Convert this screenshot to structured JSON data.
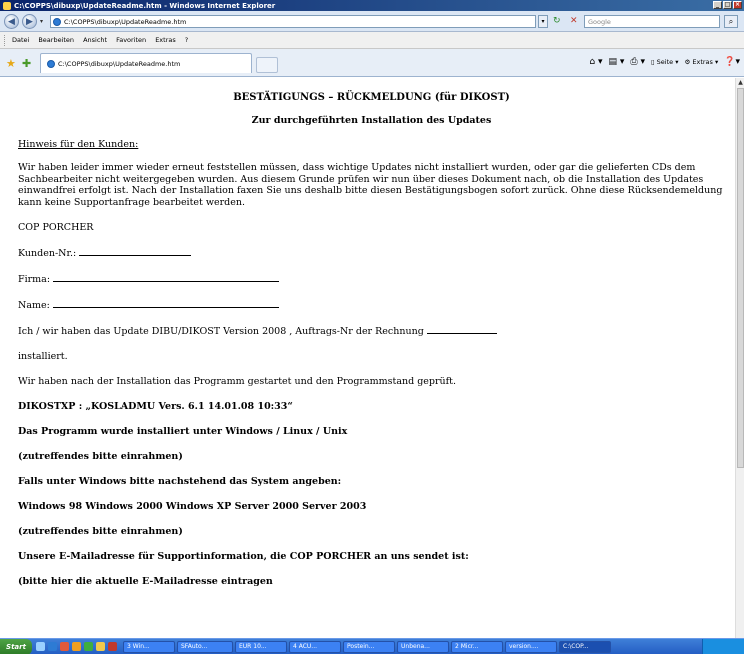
{
  "window": {
    "title": "C:\\COPPS\\dibuxp\\UpdateReadme.htm - Windows Internet Explorer"
  },
  "address_bar": {
    "url": "C:\\COPPS\\dibuxp\\UpdateReadme.htm",
    "search_placeholder": "Google"
  },
  "menu": {
    "items": [
      "Datei",
      "Bearbeiten",
      "Ansicht",
      "Favoriten",
      "Extras",
      "?"
    ]
  },
  "tabs": {
    "active_label": "C:\\COPPS\\dibuxp\\UpdateReadme.htm"
  },
  "command_bar": {
    "page_label": "Seite",
    "extras_label": "Extras"
  },
  "document": {
    "title": "BESTÄTIGUNGS – RÜCKMELDUNG (für DIKOST)",
    "subtitle": "Zur durchgeführten Installation des Updates",
    "hint_heading": "Hinweis für den Kunden:",
    "hint_text": "Wir haben leider immer wieder erneut feststellen müssen, dass wichtige Updates nicht installiert wurden, oder gar die gelieferten CDs dem Sachbearbeiter nicht weitergegeben wurden. Aus diesem Grunde prüfen wir nun über dieses Dokument nach, ob die Installation des Updates einwandfrei erfolgt ist. Nach der Installation faxen Sie uns deshalb bitte diesen Bestätigungsbogen sofort zurück. Ohne diese Rücksendemeldung kann keine Supportanfrage bearbeitet werden.",
    "company": "COP PORCHER",
    "customer_no_label": "Kunden-Nr.:",
    "firma_label": "Firma:",
    "name_label": "Name:",
    "update_sentence": "Ich / wir haben das Update DIBU/DIKOST Version 2008 , Auftrags-Nr der Rechnung",
    "installed": "installiert.",
    "started_sentence": "Wir haben nach der Installation das Programm gestartet und den Programmstand geprüft.",
    "version_line": "DIKOSTXP : „KOSLADMU Vers. 6.1 14.01.08 10:33“",
    "os_line": "Das Programm wurde installiert unter Windows / Linux / Unix",
    "mark_hint_1": "(zutreffendes bitte einrahmen)",
    "windows_prompt": "Falls unter Windows bitte nachstehend das System angeben:",
    "windows_versions": "Windows 98 Windows 2000 Windows XP Server 2000 Server 2003",
    "mark_hint_2": "(zutreffendes bitte einrahmen)",
    "email_prompt": "Unsere E-Mailadresse für Supportinformation, die COP PORCHER an uns sendet ist:",
    "email_hint": "(bitte hier die aktuelle E-Mailadresse eintragen"
  },
  "taskbar": {
    "start_label": "Start",
    "buttons": [
      "3 Win...",
      "SFAuto...",
      "EUR 10...",
      "4 ACU...",
      "Postein...",
      "Unbena...",
      "2 Micr...",
      "version....",
      "C:\\COP..."
    ]
  }
}
